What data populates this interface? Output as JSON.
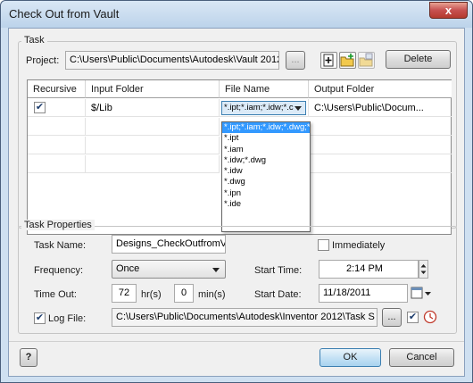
{
  "window": {
    "title": "Check Out from Vault",
    "close_glyph": "x"
  },
  "task": {
    "group_label": "Task",
    "project_label": "Project:",
    "project_value": "C:\\Users\\Public\\Documents\\Autodesk\\Vault 2012\\",
    "browse_label": "...",
    "delete_label": "Delete"
  },
  "grid": {
    "headers": [
      "Recursive",
      "Input Folder",
      "File Name",
      "Output Folder"
    ],
    "rows": [
      {
        "recursive_checked": "✔",
        "input_folder": "$/Lib",
        "file_name": "*.ipt;*.iam;*.idw;*.c",
        "output_folder": "C:\\Users\\Public\\Docum..."
      }
    ],
    "dropdown_options": [
      "*.ipt;*.iam;*.idw;*.dwg;*",
      "*.ipt",
      "*.iam",
      "*.idw;*.dwg",
      "*.idw",
      "*.dwg",
      "*.ipn",
      "*.ide"
    ]
  },
  "props": {
    "group_label": "Task Properties",
    "task_name_label": "Task Name:",
    "task_name_value": "Designs_CheckOutfromVa",
    "immediately_label": "Immediately",
    "frequency_label": "Frequency:",
    "frequency_value": "Once",
    "start_time_label": "Start Time:",
    "start_time_value": "2:14 PM",
    "timeout_label": "Time Out:",
    "timeout_hours": "72",
    "hours_unit": "hr(s)",
    "timeout_mins": "0",
    "mins_unit": "min(s)",
    "start_date_label": "Start Date:",
    "start_date_value": "11/18/2011",
    "logfile_label": "Log File:",
    "logfile_value": "C:\\Users\\Public\\Documents\\Autodesk\\Inventor 2012\\Task S",
    "logfile_browse": "..."
  },
  "footer": {
    "help_glyph": "?",
    "ok_label": "OK",
    "cancel_label": "Cancel"
  }
}
